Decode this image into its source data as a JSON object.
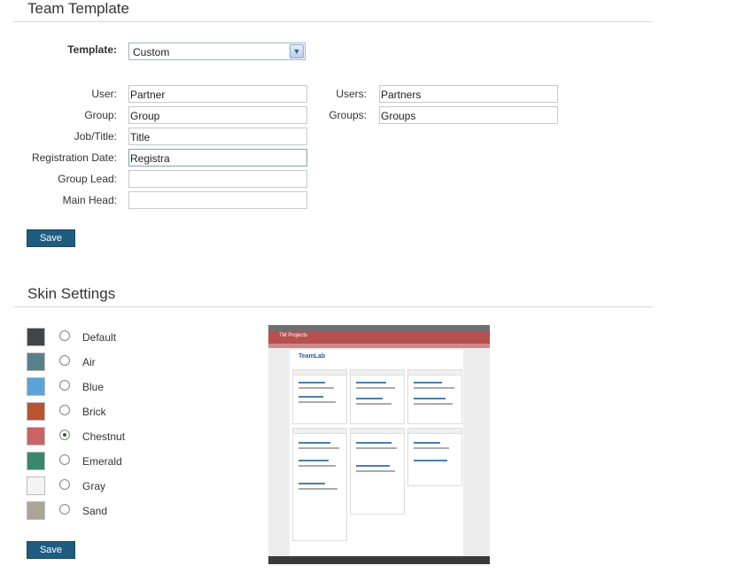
{
  "team_template": {
    "title": "Team Template",
    "template_label": "Template:",
    "template_value": "Custom",
    "fields": {
      "user": {
        "label": "User:",
        "value": "Partner"
      },
      "users": {
        "label": "Users:",
        "value": "Partners"
      },
      "group": {
        "label": "Group:",
        "value": "Group"
      },
      "groups": {
        "label": "Groups:",
        "value": "Groups"
      },
      "job_title": {
        "label": "Job/Title:",
        "value": "Title"
      },
      "registration_date": {
        "label": "Registration Date:",
        "value": "Registra"
      },
      "group_lead": {
        "label": "Group Lead:",
        "value": ""
      },
      "main_head": {
        "label": "Main Head:",
        "value": ""
      }
    },
    "save_label": "Save"
  },
  "skin_settings": {
    "title": "Skin Settings",
    "selected": "Chestnut",
    "skins": [
      {
        "name": "Default",
        "color": "#414549"
      },
      {
        "name": "Air",
        "color": "#5a7f8c"
      },
      {
        "name": "Blue",
        "color": "#5ba4d9"
      },
      {
        "name": "Brick",
        "color": "#b85530"
      },
      {
        "name": "Chestnut",
        "color": "#c96466"
      },
      {
        "name": "Emerald",
        "color": "#38886b"
      },
      {
        "name": "Gray",
        "color": "#f4f4f4"
      },
      {
        "name": "Sand",
        "color": "#aca497"
      }
    ],
    "save_label": "Save",
    "preview": {
      "header_title": "TM Projects",
      "logo_text": "TeamLab"
    }
  },
  "colors": {
    "button_bg": "#1f5d80",
    "preview_header": "#b64f50"
  }
}
